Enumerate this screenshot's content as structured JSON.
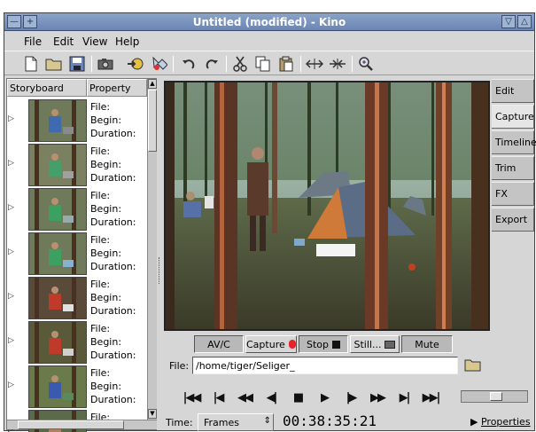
{
  "window": {
    "title": "Untitled (modified) - Kino",
    "minimize_glyph": "—",
    "restore_glyph": "+",
    "collapse_glyph": "▽",
    "maximize_glyph": "△"
  },
  "menu": {
    "file": "File",
    "edit": "Edit",
    "view": "View",
    "help": "Help"
  },
  "toolbar_icons": [
    "new-file-icon",
    "open-folder-icon",
    "save-icon",
    "camera-icon",
    "import-icon",
    "export-icon",
    "undo-icon",
    "redo-icon",
    "cut-icon",
    "copy-icon",
    "paste-icon",
    "split-icon",
    "join-icon",
    "zoom-icon"
  ],
  "storyboard": {
    "col_storyboard": "Storyboard",
    "col_property": "Property",
    "file_label": "File:",
    "begin_label": "Begin:",
    "duration_label": "Duration:",
    "rows": 8
  },
  "tabs": [
    "Edit",
    "Capture",
    "Timeline",
    "Trim",
    "FX",
    "Export"
  ],
  "active_tab": "Capture",
  "capture": {
    "avc": "AV/C",
    "capture": "Capture",
    "stop": "Stop",
    "still": "Still...",
    "mute": "Mute",
    "file_label": "File:",
    "file_value": "/home/tiger/Seliger_"
  },
  "transport_glyphs": [
    "⏮",
    "⏮",
    "◀◀",
    "◀|",
    "■",
    "▶",
    "|▶",
    "▶▶",
    "▶|",
    "⏭"
  ],
  "bottom": {
    "time_label": "Time:",
    "time_mode": "Frames",
    "spin_glyph": "⇕",
    "timecode": "00:38:35:21",
    "properties": "Properties",
    "properties_arrow": "▶"
  },
  "colors": {
    "titlebar": "#7b94c0",
    "record": "#e8222a"
  }
}
